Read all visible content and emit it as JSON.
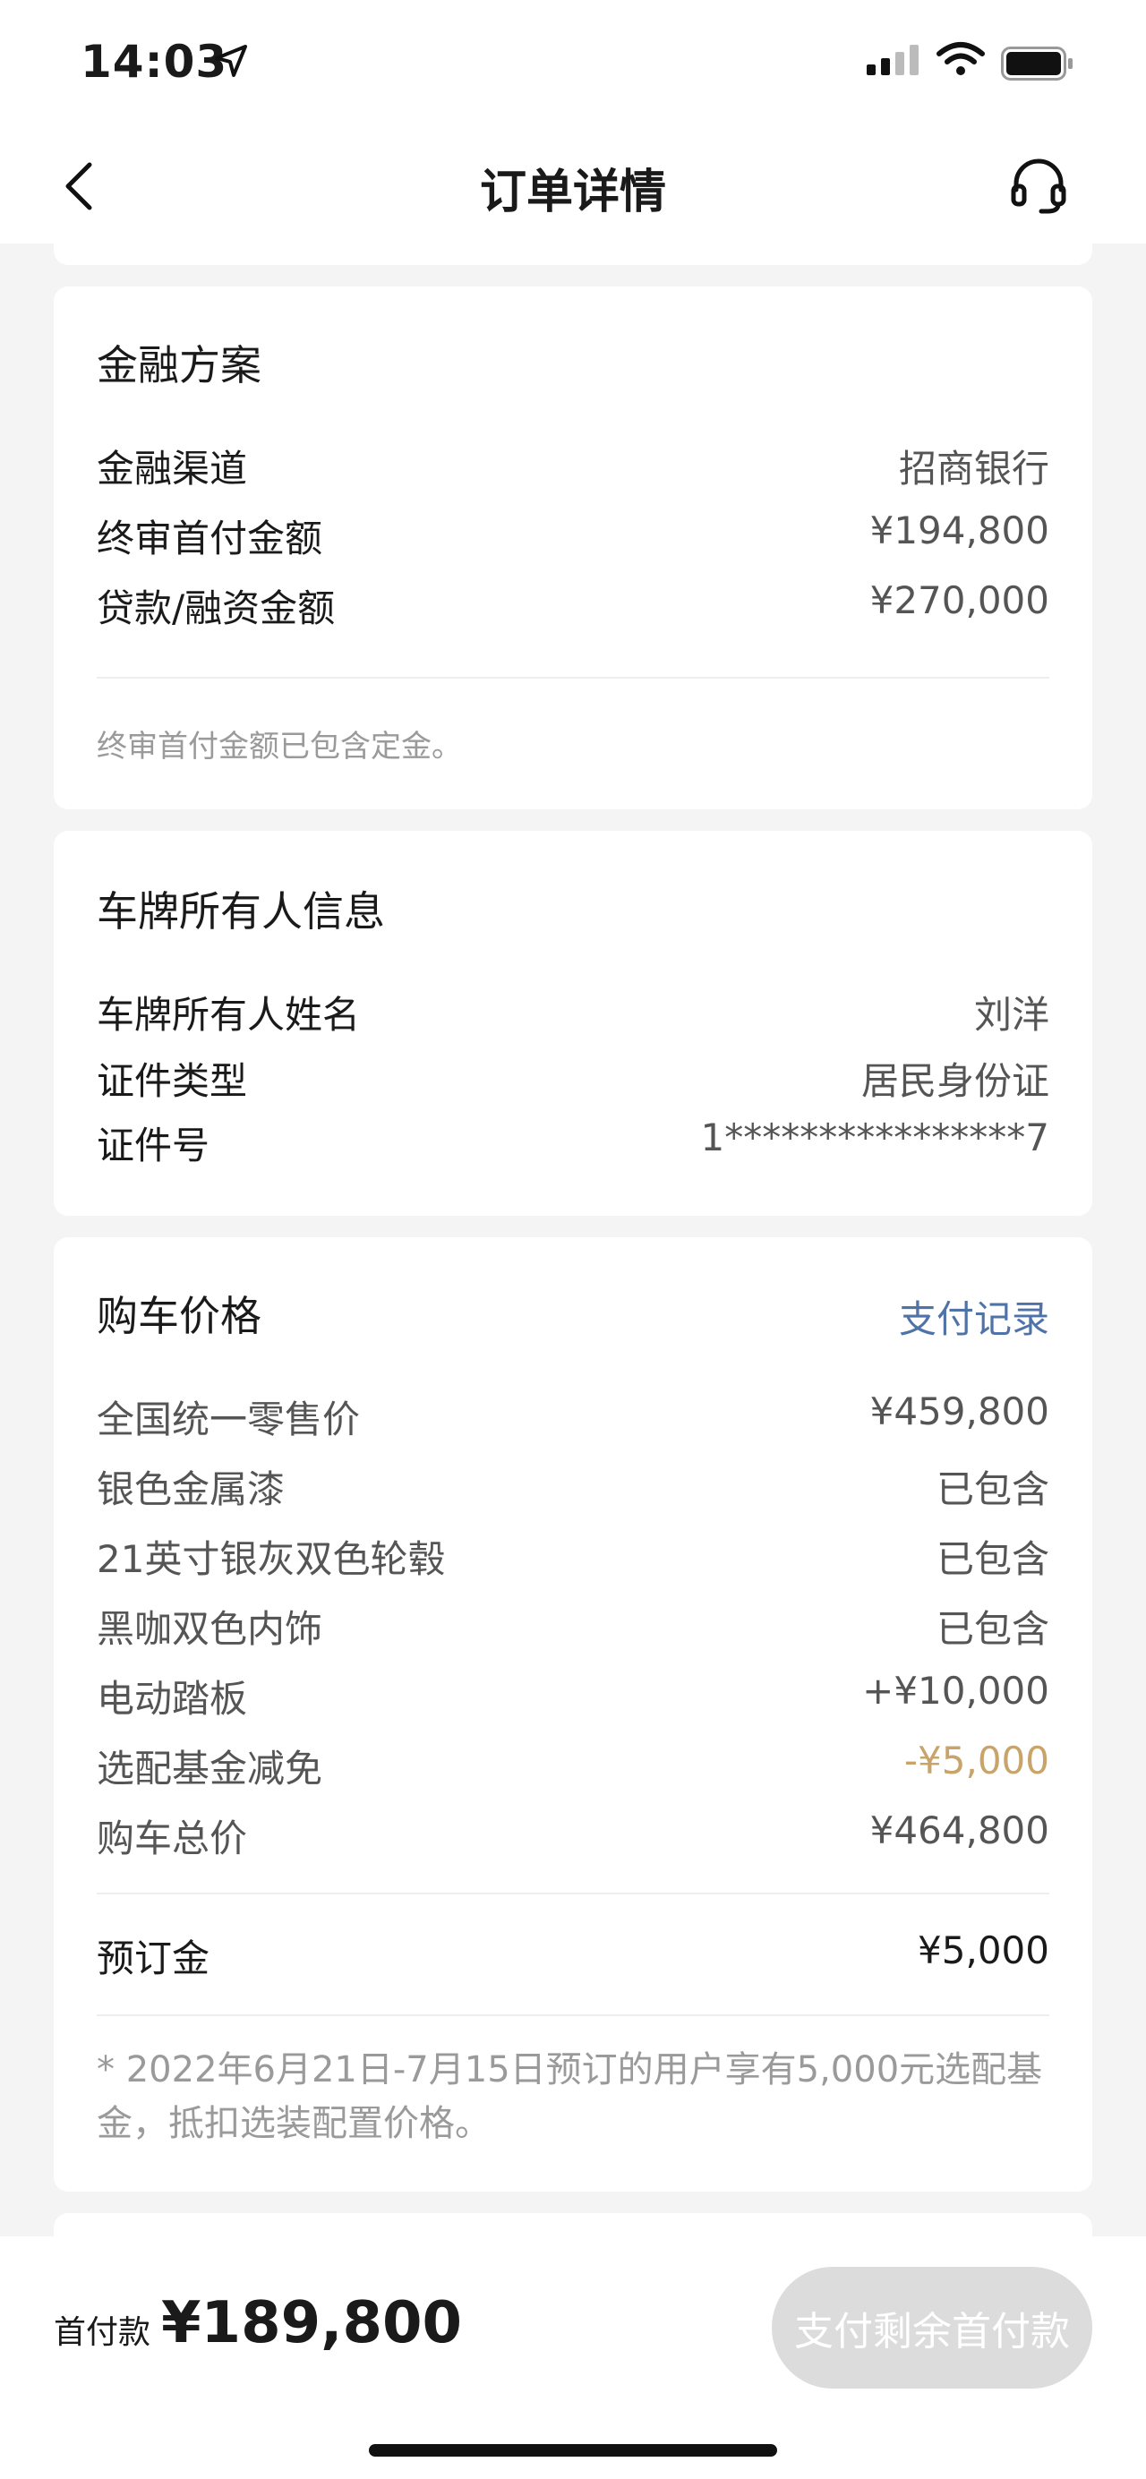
{
  "status_bar": {
    "time": "14:03"
  },
  "nav": {
    "title": "订单详情"
  },
  "finance": {
    "title": "金融方案",
    "rows": [
      {
        "label": "金融渠道",
        "value": "招商银行"
      },
      {
        "label": "终审首付金额",
        "value": "¥194,800"
      },
      {
        "label": "贷款/融资金额",
        "value": "¥270,000"
      }
    ],
    "note": "终审首付金额已包含定金。"
  },
  "owner": {
    "title": "车牌所有人信息",
    "rows": [
      {
        "label": "车牌所有人姓名",
        "value": "刘洋"
      },
      {
        "label": "证件类型",
        "value": "居民身份证"
      },
      {
        "label": "证件号",
        "value": "1****************7"
      }
    ]
  },
  "price": {
    "title": "购车价格",
    "link": "支付记录",
    "rows": [
      {
        "label": "全国统一零售价",
        "value": "¥459,800"
      },
      {
        "label": "银色金属漆",
        "value": "已包含"
      },
      {
        "label": "21英寸银灰双色轮毂",
        "value": "已包含"
      },
      {
        "label": "黑咖双色内饰",
        "value": "已包含"
      },
      {
        "label": "电动踏板",
        "value": "+¥10,000"
      },
      {
        "label": "选配基金减免",
        "value": "-¥5,000"
      },
      {
        "label": "购车总价",
        "value": "¥464,800"
      }
    ],
    "deposit": {
      "label": "预订金",
      "value": "¥5,000"
    },
    "note": "* 2022年6月21日-7月15日预订的用户享有5,000元选配基金，抵扣选装配置价格。"
  },
  "bottom": {
    "down_payment_label": "首付款",
    "down_payment_amount": "¥189,800",
    "pay_button": "支付剩余首付款"
  },
  "colors": {
    "link": "#4f73a8",
    "discount": "#c8a46b",
    "disabled_button": "#dcdcdc",
    "background": "#f4f4f4"
  }
}
